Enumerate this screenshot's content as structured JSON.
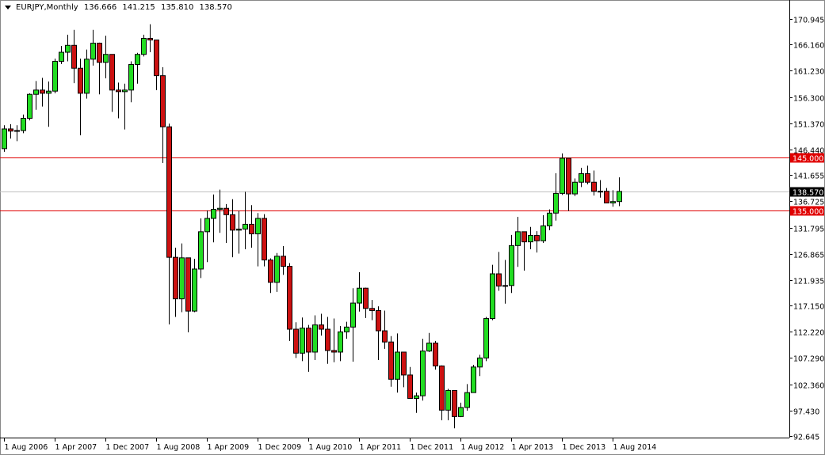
{
  "header": {
    "symbol": "EURJPY,Monthly",
    "open": "136.666",
    "high": "141.215",
    "low": "135.810",
    "close": "138.570"
  },
  "chart_data": {
    "type": "candlestick",
    "title": "EURJPY,Monthly",
    "start_month": "Aug 2006",
    "end_month": "Sep 2014",
    "first_open": 146.6,
    "close": [
      150.3,
      149.9,
      150.0,
      152.3,
      156.8,
      157.6,
      157.0,
      157.4,
      163.0,
      164.7,
      166.0,
      161.7,
      157.0,
      163.4,
      166.4,
      162.8,
      164.3,
      157.6,
      157.3,
      157.6,
      162.4,
      164.3,
      167.3,
      167.0,
      160.3,
      150.7,
      126.2,
      118.4,
      126.1,
      116.1,
      124.0,
      131.0,
      133.5,
      135.2,
      135.4,
      134.2,
      131.3,
      131.5,
      132.4,
      130.6,
      133.5,
      125.7,
      121.5,
      126.4,
      124.5,
      112.7,
      108.2,
      112.9,
      108.4,
      113.5,
      112.7,
      108.7,
      108.4,
      112.2,
      113.1,
      117.6,
      120.4,
      116.6,
      116.2,
      112.4,
      110.3,
      103.3,
      108.4,
      104.1,
      99.7,
      100.2,
      108.6,
      110.1,
      105.8,
      97.5,
      101.2,
      96.3,
      98.0,
      100.8,
      105.6,
      107.3,
      114.7,
      123.1,
      120.8,
      120.9,
      128.4,
      131.0,
      129.1,
      130.3,
      129.3,
      132.1,
      134.5,
      138.2,
      144.8,
      138.1,
      140.3,
      141.9,
      140.3,
      138.6,
      138.6,
      136.4,
      136.666,
      138.57
    ],
    "high": [
      151.0,
      151.2,
      151.0,
      153.0,
      157.0,
      159.3,
      159.9,
      159.2,
      163.5,
      165.9,
      168.0,
      168.9,
      163.5,
      165.2,
      168.9,
      166.5,
      167.8,
      164.0,
      159.0,
      158.8,
      163.0,
      164.6,
      168.0,
      169.96,
      163.3,
      161.9,
      151.3,
      128.0,
      128.8,
      126.1,
      125.9,
      133.5,
      135.0,
      138.0,
      138.9,
      136.2,
      137.1,
      134.9,
      138.5,
      136.0,
      134.5,
      134.3,
      126.0,
      127.0,
      128.3,
      125.1,
      114.0,
      114.9,
      113.5,
      115.3,
      115.6,
      115.0,
      114.7,
      113.3,
      114.1,
      120.4,
      123.4,
      120.5,
      118.2,
      117.0,
      116.2,
      111.4,
      111.9,
      105.7,
      105.6,
      100.8,
      110.9,
      112.0,
      110.5,
      105.9,
      101.5,
      98.6,
      98.9,
      102.4,
      106.0,
      107.9,
      115.0,
      124.8,
      127.2,
      125.7,
      130.4,
      133.8,
      130.9,
      131.9,
      131.1,
      134.1,
      135.2,
      142.0,
      145.7,
      143.8,
      141.0,
      143.0,
      143.4,
      142.5,
      140.7,
      139.2,
      138.8,
      141.215
    ],
    "low": [
      146.0,
      148.5,
      148.0,
      149.5,
      151.9,
      153.9,
      154.5,
      150.7,
      157.0,
      162.5,
      163.0,
      158.9,
      149.1,
      156.0,
      162.2,
      156.8,
      159.8,
      153.5,
      152.3,
      150.2,
      155.3,
      158.8,
      163.9,
      164.7,
      157.6,
      143.9,
      113.6,
      115.0,
      115.9,
      112.1,
      115.9,
      122.3,
      125.3,
      129.0,
      130.8,
      128.9,
      126.2,
      126.9,
      127.7,
      128.0,
      124.5,
      124.5,
      119.5,
      119.7,
      122.9,
      110.5,
      107.3,
      106.7,
      104.7,
      106.9,
      111.5,
      106.2,
      106.5,
      106.7,
      110.9,
      106.6,
      116.0,
      114.8,
      114.4,
      106.9,
      109.0,
      101.9,
      100.8,
      101.8,
      99.7,
      97.0,
      99.3,
      108.4,
      105.1,
      95.6,
      95.6,
      94.1,
      96.2,
      97.4,
      100.8,
      103.9,
      106.7,
      114.4,
      119.9,
      117.5,
      119.5,
      124.4,
      123.7,
      127.7,
      127.1,
      128.9,
      131.3,
      133.1,
      137.9,
      134.9,
      137.7,
      139.4,
      139.9,
      137.8,
      137.4,
      136.6,
      135.7,
      135.81
    ],
    "ylim": [
      92.645,
      170.945
    ],
    "y_ticks": [
      "170.945",
      "166.160",
      "161.230",
      "156.300",
      "151.370",
      "146.440",
      "141.655",
      "136.725",
      "131.795",
      "126.865",
      "121.935",
      "117.150",
      "112.220",
      "107.290",
      "102.360",
      "97.430",
      "92.645"
    ],
    "x_ticks": [
      "1 Aug 2006",
      "1 Apr 2007",
      "1 Dec 2007",
      "1 Aug 2008",
      "1 Apr 2009",
      "1 Dec 2009",
      "1 Aug 2010",
      "1 Apr 2011",
      "1 Dec 2011",
      "1 Aug 2012",
      "1 Apr 2013",
      "1 Dec 2013",
      "1 Aug 2014"
    ],
    "x_tick_every_months": 8,
    "hlines": [
      {
        "value": 145.0,
        "label": "145.000",
        "color": "#e00000"
      },
      {
        "value": 135.0,
        "label": "135.000",
        "color": "#e00000"
      }
    ],
    "bid_line": {
      "value": 138.57,
      "label": "138.570",
      "color": "#c0c0c0"
    },
    "colors": {
      "bull": "#22dd22",
      "bear": "#cc1111",
      "outline": "#000000"
    }
  }
}
